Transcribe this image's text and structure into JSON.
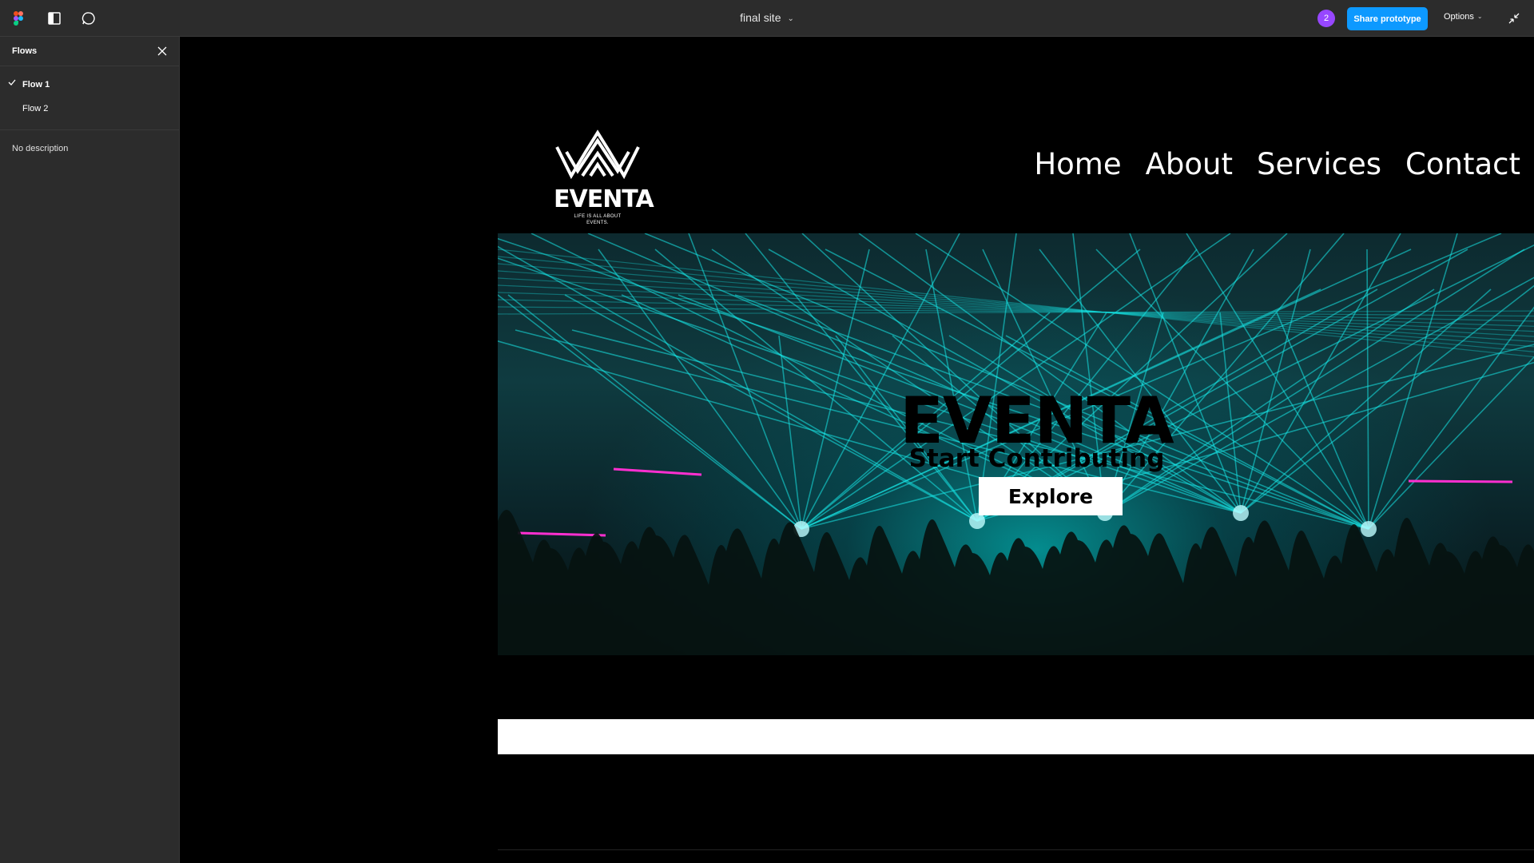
{
  "toolbar": {
    "file_title": "final site",
    "avatar_count": "2",
    "share_label": "Share prototype",
    "options_label": "Options",
    "icons": [
      "figma-logo-icon",
      "panel-toggle-icon",
      "comment-icon",
      "chevron-down-icon",
      "collapse-icon"
    ]
  },
  "sidebar": {
    "title": "Flows",
    "flows": [
      {
        "label": "Flow 1",
        "active": true
      },
      {
        "label": "Flow 2",
        "active": false
      }
    ],
    "description": "No description"
  },
  "site": {
    "logo": {
      "wordmark": "EVENTA",
      "tagline_1": "LIFE IS ALL ABOUT",
      "tagline_2": "EVENTS."
    },
    "nav": [
      "Home",
      "About",
      "Services",
      "Contact"
    ],
    "hero": {
      "title": "EVENTA",
      "subtitle": "Start Contributing",
      "button": "Explore"
    }
  },
  "colors": {
    "toolbar_bg": "#2c2c2c",
    "accent": "#0d99ff",
    "avatar": "#9747ff",
    "laser": "#18e6e6",
    "magenta": "#ff2fd0"
  }
}
